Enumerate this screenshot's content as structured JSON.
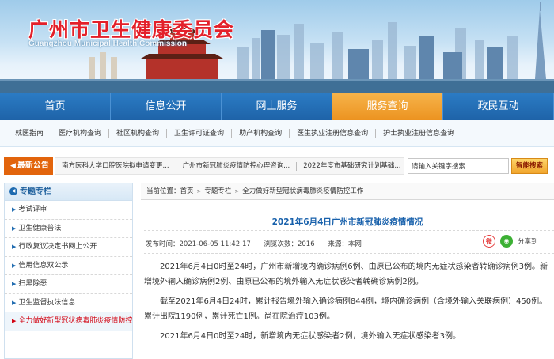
{
  "header": {
    "title": "广州市卫生健康委员会",
    "subtitle": "Guangzhou Municipal Health Commission"
  },
  "mainnav": [
    "首页",
    "信息公开",
    "网上服务",
    "服务查询",
    "政民互动"
  ],
  "mainnav_active": "服务查询",
  "subnav": [
    "就医指南",
    "医疗机构查询",
    "社区机构查询",
    "卫生许可证查询",
    "助产机构查询",
    "医生执业注册信息查询",
    "护士执业注册信息查询"
  ],
  "notice": {
    "label": "最新公告",
    "items": [
      "南方医科大学口腔医院拟申请变更...",
      "广州市新冠肺炎疫情防控心理咨询...",
      "2022年度市基础研究计划基础..."
    ],
    "search_placeholder": "请输入关键字搜索",
    "search_button": "智能搜索"
  },
  "sidebar": {
    "heading": "专题专栏",
    "items": [
      "考试评审",
      "卫生健康普法",
      "行政复议决定书网上公开",
      "信用信息双公示",
      "扫黑除恶",
      "卫生监督执法信息",
      "全力做好新型冠状病毒肺炎疫情防控工作"
    ],
    "active_index": 6
  },
  "breadcrumb": {
    "prefix": "当前位置：",
    "items": [
      "首页",
      "专题专栏",
      "全力做好新型冠状病毒肺炎疫情防控工作"
    ]
  },
  "article": {
    "title": "2021年6月4日广州市新冠肺炎疫情情况",
    "publish_time": "发布时间：2021-06-05 11:42:17",
    "views": "浏览次数：2016",
    "source": "来源：本网",
    "share_text": "分享到",
    "paragraphs": [
      "2021年6月4日0时至24时，广州市新增境内确诊病例6例、由原已公布的境内无症状感染者转确诊病例3例。新增境外输入确诊病例2例、由原已公布的境外输入无症状感染者转确诊病例2例。",
      "截至2021年6月4日24时，累计报告境外输入确诊病例844例，境内确诊病例（含境外输入关联病例）450例。累计出院1190例，累计死亡1例。尚在院治疗103例。",
      "2021年6月4日0时至24时，新增境内无症状感染者2例，境外输入无症状感染者3例。"
    ]
  }
}
